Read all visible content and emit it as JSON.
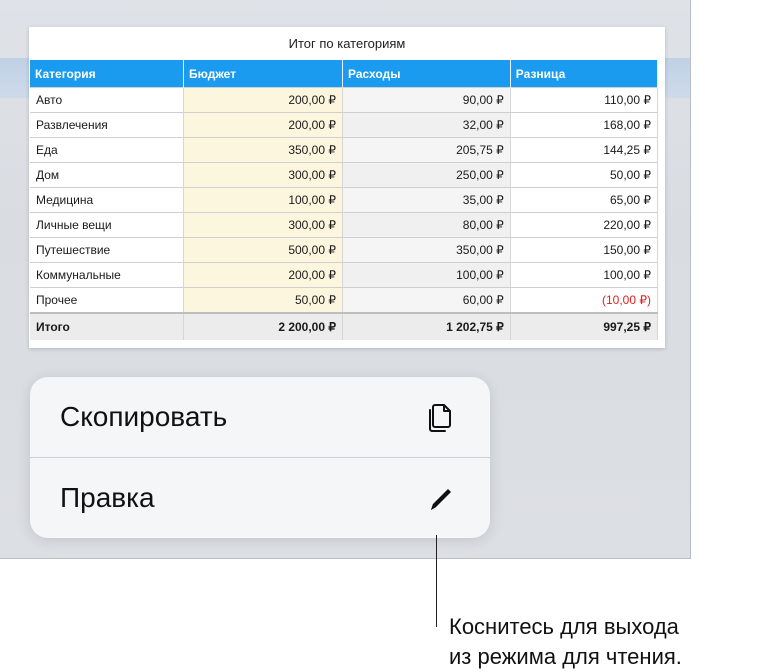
{
  "table": {
    "title": "Итог по категориям",
    "headers": [
      "Категория",
      "Бюджет",
      "Расходы",
      "Разница"
    ],
    "rows": [
      {
        "category": "Авто",
        "budget": "200,00 ₽",
        "expenses": "90,00 ₽",
        "difference": "110,00 ₽"
      },
      {
        "category": "Развлечения",
        "budget": "200,00 ₽",
        "expenses": "32,00 ₽",
        "difference": "168,00 ₽"
      },
      {
        "category": "Еда",
        "budget": "350,00 ₽",
        "expenses": "205,75 ₽",
        "difference": "144,25 ₽"
      },
      {
        "category": "Дом",
        "budget": "300,00 ₽",
        "expenses": "250,00 ₽",
        "difference": "50,00 ₽"
      },
      {
        "category": "Медицина",
        "budget": "100,00 ₽",
        "expenses": "35,00 ₽",
        "difference": "65,00 ₽"
      },
      {
        "category": "Личные вещи",
        "budget": "300,00 ₽",
        "expenses": "80,00 ₽",
        "difference": "220,00 ₽"
      },
      {
        "category": "Путешествие",
        "budget": "500,00 ₽",
        "expenses": "350,00 ₽",
        "difference": "150,00 ₽"
      },
      {
        "category": "Коммунальные",
        "budget": "200,00 ₽",
        "expenses": "100,00 ₽",
        "difference": "100,00 ₽"
      },
      {
        "category": "Прочее",
        "budget": "50,00 ₽",
        "expenses": "60,00 ₽",
        "difference": "(10,00 ₽)"
      }
    ],
    "total": {
      "category": "Итого",
      "budget": "2 200,00 ₽",
      "expenses": "1 202,75 ₽",
      "difference": "997,25 ₽"
    }
  },
  "menu": {
    "copy_label": "Скопировать",
    "copy_icon": "copy-icon",
    "edit_label": "Правка",
    "edit_icon": "pencil-icon"
  },
  "callout": {
    "line1": "Коснитесь для выхода",
    "line2": "из режима для чтения."
  },
  "colors": {
    "header_blue": "#1a9bf0",
    "budget_fill": "#fdf6de",
    "negative_red": "#e02020"
  }
}
